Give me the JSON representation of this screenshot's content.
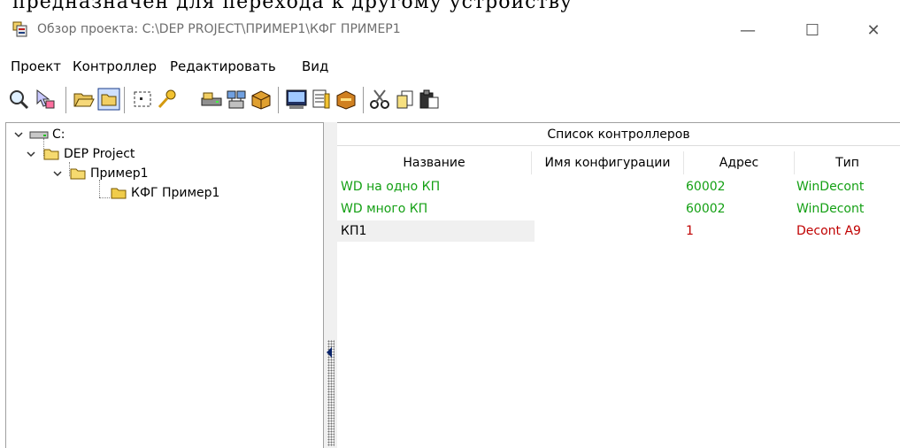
{
  "page_top_text": "предназначен для перехода к другому устройству",
  "window": {
    "title": "Обзор проекта: C:\\DEP PROJECT\\ПРИМЕР1\\КФГ ПРИМЕР1",
    "minimize": "—",
    "maximize": "☐",
    "close": "✕"
  },
  "menu": [
    "Проект",
    "Контроллер",
    "Редактировать",
    "Вид"
  ],
  "tree": {
    "drive": "C:",
    "project": "DEP Project",
    "folder": "Пример1",
    "config": "КФГ Пример1"
  },
  "list": {
    "title": "Список контроллеров",
    "columns": [
      "Название",
      "Имя конфигурации",
      "Адрес",
      "Тип"
    ],
    "rows": [
      {
        "name": "WD на одно КП",
        "config": "",
        "address": "60002",
        "type": "WinDecont",
        "color": "#14a014"
      },
      {
        "name": "WD много КП",
        "config": "",
        "address": "60002",
        "type": "WinDecont",
        "color": "#14a014"
      },
      {
        "name": "КП1",
        "config": "",
        "address": "1",
        "type": "Decont A9",
        "color": "#c00000"
      }
    ]
  },
  "colors": {
    "green": "#14a014",
    "red": "#c00000"
  }
}
